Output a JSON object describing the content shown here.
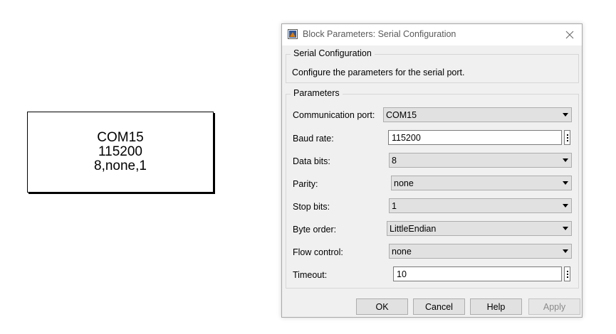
{
  "block": {
    "line1": "COM15",
    "line2": "115200",
    "line3": "8,none,1"
  },
  "dialog": {
    "title": "Block Parameters: Serial Configuration",
    "section": {
      "legend": "Serial Configuration",
      "description": "Configure the parameters for the serial port."
    },
    "params": {
      "legend": "Parameters",
      "comm_port": {
        "label": "Communication port:",
        "value": "COM15"
      },
      "baud_rate": {
        "label": "Baud rate:",
        "value": "115200"
      },
      "data_bits": {
        "label": "Data bits:",
        "value": "8"
      },
      "parity": {
        "label": "Parity:",
        "value": "none"
      },
      "stop_bits": {
        "label": "Stop bits:",
        "value": "1"
      },
      "byte_order": {
        "label": "Byte order:",
        "value": "LittleEndian"
      },
      "flow_control": {
        "label": "Flow control:",
        "value": "none"
      },
      "timeout": {
        "label": "Timeout:",
        "value": "10"
      }
    },
    "buttons": {
      "ok": "OK",
      "cancel": "Cancel",
      "help": "Help",
      "apply": "Apply"
    }
  },
  "icons": {
    "title_icon": "simulink-block-icon",
    "close": "close-icon",
    "dropdown_arrow": "chevron-down-icon",
    "more": "vertical-ellipsis-icon"
  }
}
